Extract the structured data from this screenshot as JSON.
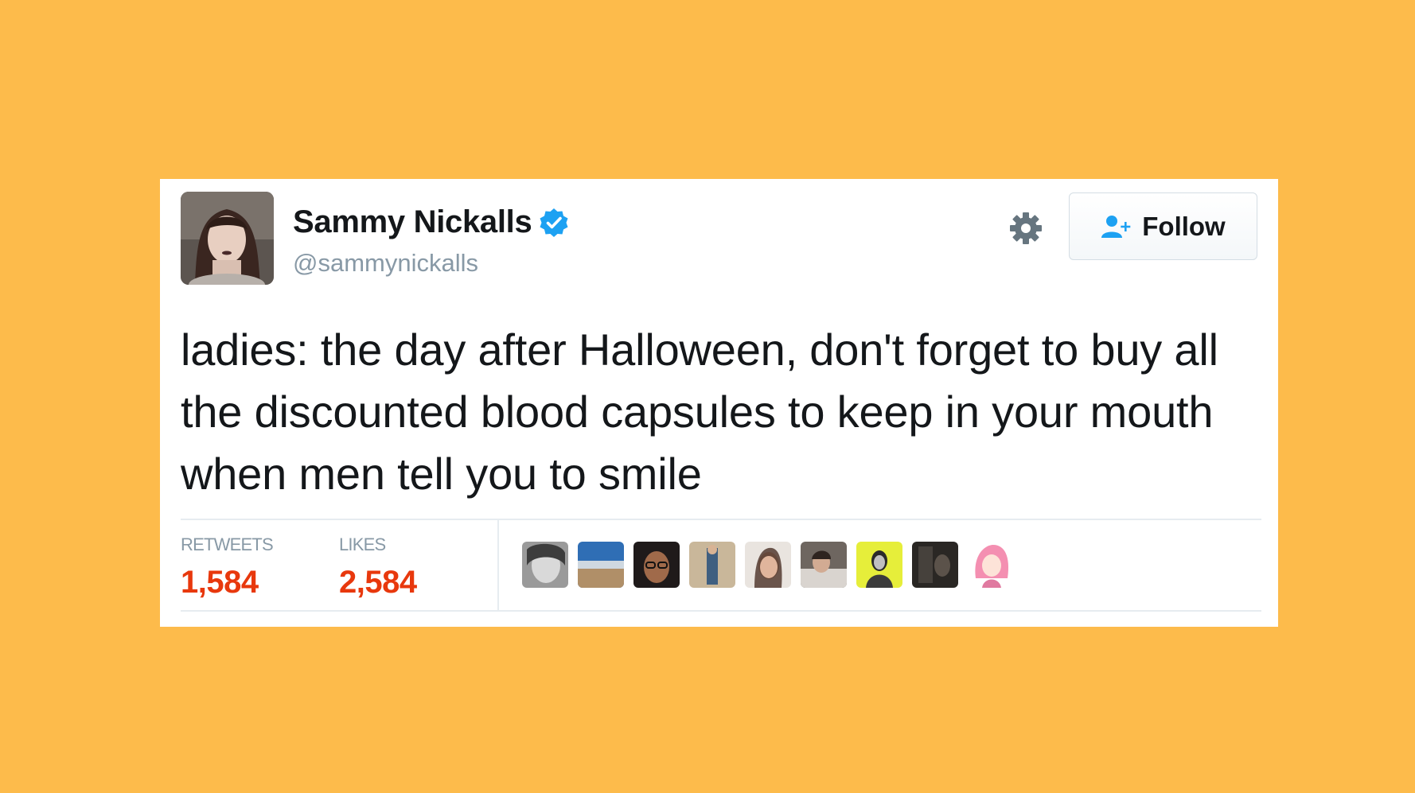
{
  "tweet": {
    "author": {
      "display_name": "Sammy Nickalls",
      "handle": "@sammynickalls",
      "verified": true
    },
    "follow_label": "Follow",
    "text": "ladies: the day after Halloween, don't forget to buy all the discounted blood capsules to keep in your mouth when men tell you to smile",
    "stats": {
      "retweets_label": "RETWEETS",
      "retweets_count": "1,584",
      "likes_label": "LIKES",
      "likes_count": "2,584"
    },
    "liker_avatar_count": 9
  },
  "colors": {
    "background": "#FDBB4B",
    "card": "#FFFFFF",
    "verified_blue": "#1DA1F2",
    "stat_count_red": "#E8380D",
    "muted_gray": "#8899A6"
  },
  "icons": [
    "verified-badge-icon",
    "gear-icon",
    "follow-user-icon"
  ]
}
